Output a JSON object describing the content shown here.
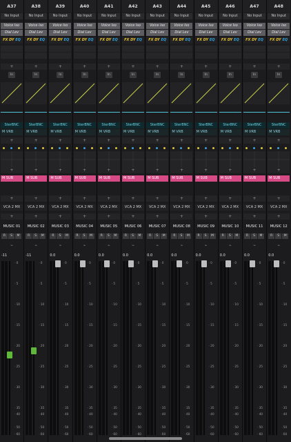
{
  "channels": [
    {
      "id": "A37",
      "input": "No Input",
      "plugin1": "Voice Iso",
      "plugin2": "Dial Lev",
      "fx": "FX",
      "dy": "DY",
      "eq": "EQ",
      "in": "In",
      "bus": "SterBNC",
      "bus2": "M VRB",
      "sub": "M SUB",
      "vca": "VCA 2 MX",
      "name": "MUSIC 01",
      "level": "-11",
      "fader_db": -22
    },
    {
      "id": "A38",
      "input": "No Input",
      "plugin1": "Voice Iso",
      "plugin2": "Dial Lev",
      "fx": "FX",
      "dy": "DY",
      "eq": "EQ",
      "in": "In",
      "bus": "SterBNC",
      "bus2": "M VRB",
      "sub": "M SUB",
      "vca": "VCA 2 MX",
      "name": "MUSIC 02",
      "level": "-11",
      "fader_db": -21
    },
    {
      "id": "A39",
      "input": "No Input",
      "plugin1": "Voice Iso",
      "plugin2": "Dial Lev",
      "fx": "FX",
      "dy": "DY",
      "eq": "EQ",
      "in": "In",
      "bus": "SterBNC",
      "bus2": "M VRB",
      "sub": "M SUB",
      "vca": "VCA 2 MX",
      "name": "MUSIC 03",
      "level": "0.0",
      "fader_db": 0
    },
    {
      "id": "A40",
      "input": "No Input",
      "plugin1": "Voice Iso",
      "plugin2": "Dial Lev",
      "fx": "FX",
      "dy": "DY",
      "eq": "EQ",
      "in": "In",
      "bus": "SterBNC",
      "bus2": "M VRB",
      "sub": "M SUB",
      "vca": "VCA 2 MX",
      "name": "MUSIC 04",
      "level": "0.0",
      "fader_db": 0
    },
    {
      "id": "A41",
      "input": "No Input",
      "plugin1": "Voice Iso",
      "plugin2": "Dial Lev",
      "fx": "FX",
      "dy": "DY",
      "eq": "EQ",
      "in": "In",
      "bus": "SterBNC",
      "bus2": "M VRB",
      "sub": "M SUB",
      "vca": "VCA 2 MX",
      "name": "MUSIC 05",
      "level": "0.0",
      "fader_db": 0
    },
    {
      "id": "A42",
      "input": "No Input",
      "plugin1": "Voice Iso",
      "plugin2": "Dial Lev",
      "fx": "FX",
      "dy": "DY",
      "eq": "EQ",
      "in": "In",
      "bus": "SterBNC",
      "bus2": "M VRB",
      "sub": "M SUB",
      "vca": "VCA 2 MX",
      "name": "MUSIC 06",
      "level": "0.0",
      "fader_db": 0
    },
    {
      "id": "A43",
      "input": "No Input",
      "plugin1": "Voice Iso",
      "plugin2": "Dial Lev",
      "fx": "FX",
      "dy": "DY",
      "eq": "EQ",
      "in": "In",
      "bus": "SterBNC",
      "bus2": "M VRB",
      "sub": "M SUB",
      "vca": "VCA 2 MX",
      "name": "MUSIC 07",
      "level": "0.0",
      "fader_db": 0
    },
    {
      "id": "A44",
      "input": "No Input",
      "plugin1": "Voice Iso",
      "plugin2": "Dial Lev",
      "fx": "FX",
      "dy": "DY",
      "eq": "EQ",
      "in": "In",
      "bus": "SterBNC",
      "bus2": "M VRB",
      "sub": "M SUB",
      "vca": "VCA 2 MX",
      "name": "MUSIC 08",
      "level": "0.0",
      "fader_db": 0
    },
    {
      "id": "A45",
      "input": "No Input",
      "plugin1": "Voice Iso",
      "plugin2": "Dial Lev",
      "fx": "FX",
      "dy": "DY",
      "eq": "EQ",
      "in": "In",
      "bus": "SterBNC",
      "bus2": "M VRB",
      "sub": "M SUB",
      "vca": "VCA 2 MX",
      "name": "MUSIC 09",
      "level": "0.0",
      "fader_db": 0
    },
    {
      "id": "A46",
      "input": "No Input",
      "plugin1": "Voice Iso",
      "plugin2": "Dial Lev",
      "fx": "FX",
      "dy": "DY",
      "eq": "EQ",
      "in": "In",
      "bus": "SterBNC",
      "bus2": "M VRB",
      "sub": "M SUB",
      "vca": "VCA 2 MX",
      "name": "MUSIC 10",
      "level": "0.0",
      "fader_db": 0
    },
    {
      "id": "A47",
      "input": "No Input",
      "plugin1": "Voice Iso",
      "plugin2": "Dial Lev",
      "fx": "FX",
      "dy": "DY",
      "eq": "EQ",
      "in": "In",
      "bus": "SterBNC",
      "bus2": "M VRB",
      "sub": "M SUB",
      "vca": "VCA 2 MX",
      "name": "MUSIC 11",
      "level": "0.0",
      "fader_db": 0
    },
    {
      "id": "A48",
      "input": "No Input",
      "plugin1": "Voice Iso",
      "plugin2": "Dial Lev",
      "fx": "FX",
      "dy": "DY",
      "eq": "EQ",
      "in": "In",
      "bus": "SterBNC",
      "bus2": "M VRB",
      "sub": "M SUB",
      "vca": "VCA 2 MX",
      "name": "MUSIC 12",
      "level": "0.0",
      "fader_db": 0
    }
  ],
  "rsm_labels": [
    "R",
    "S",
    "M"
  ],
  "plus_glyph": "+",
  "link_glyph": "⌁",
  "fader_scale": [
    "0",
    "5",
    "10",
    "15",
    "20",
    "25",
    "30",
    "35",
    "40",
    "50",
    "60"
  ],
  "colors": {
    "fader_active": "#5fb83a",
    "fader_idle": "#bdbdbd",
    "msub": "#d64a86",
    "eq_curve": "#c9d24a",
    "bus_line": "#4fc7d9",
    "dot_blue": "#3aa0e0",
    "dot_yellow": "#d9c93a"
  }
}
